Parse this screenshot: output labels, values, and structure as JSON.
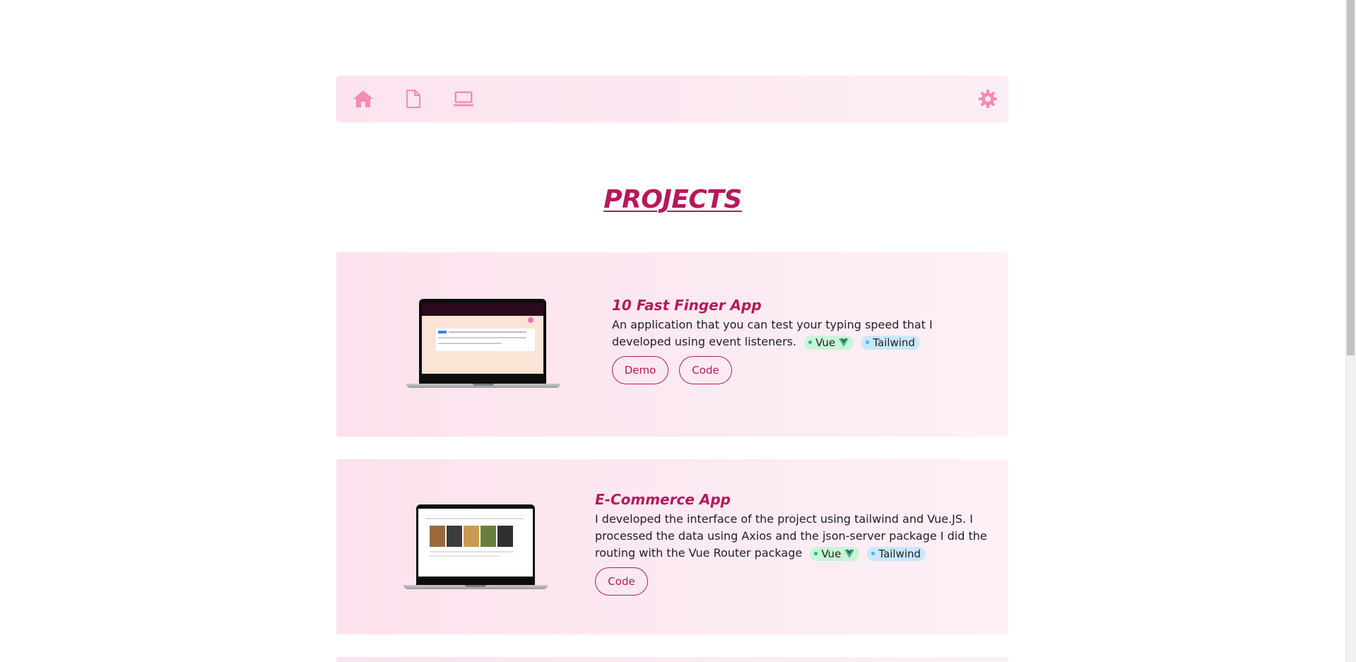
{
  "navbar": {
    "icons": [
      "home-icon",
      "document-icon",
      "laptop-icon",
      "settings-icon"
    ],
    "color": "#f58ab8"
  },
  "page": {
    "title": "PROJECTS"
  },
  "projects": [
    {
      "title": "10 Fast Finger App",
      "description": "An application that you can test your typing speed that I developed using event listeners.",
      "tags": [
        "Vue",
        "Tailwind"
      ],
      "buttons": [
        "Demo",
        "Code"
      ]
    },
    {
      "title": "E-Commerce App",
      "description": "I developed the interface of the project using tailwind and Vue.JS. I processed the data using Axios and the json-server package I did the routing with the Vue Router package",
      "tags": [
        "Vue",
        "Tailwind"
      ],
      "buttons": [
        "Code"
      ]
    }
  ],
  "colors": {
    "accent": "#b5195b",
    "card_bg": "#fce2ee",
    "vue_tag": "#c8f5d6",
    "tailwind_tag": "#c9e8fb"
  }
}
